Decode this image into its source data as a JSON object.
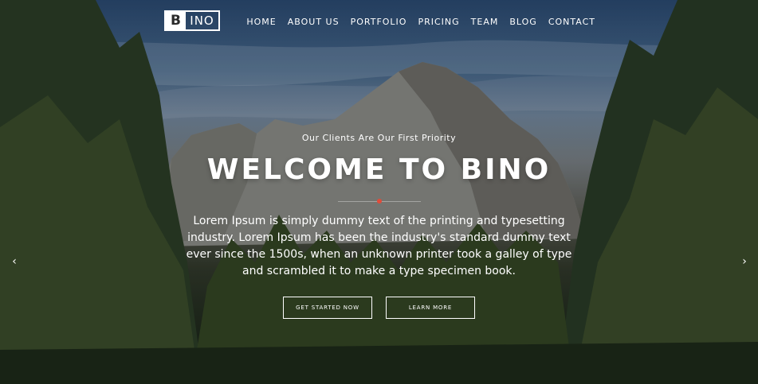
{
  "brand": {
    "logo_mark": "B",
    "logo_rest": "INO"
  },
  "nav": {
    "items": [
      {
        "label": "HOME"
      },
      {
        "label": "ABOUT US"
      },
      {
        "label": "PORTFOLIO"
      },
      {
        "label": "PRICING"
      },
      {
        "label": "TEAM"
      },
      {
        "label": "BLOG"
      },
      {
        "label": "CONTACT"
      }
    ]
  },
  "hero": {
    "kicker": "Our Clients Are Our First Priority",
    "title": "WELCOME TO BINO",
    "description": "Lorem Ipsum is simply dummy text of the printing and typesetting industry. Lorem Ipsum has been the industry's standard dummy text ever since the 1500s, when an unknown printer took a galley of type and scrambled it to make a type specimen book.",
    "primary_button": "GET STARTED NOW",
    "secondary_button": "LEARN MORE",
    "accent_color": "#e14b3a"
  },
  "slider": {
    "prev_icon": "chevron-left-icon",
    "next_icon": "chevron-right-icon",
    "prev_glyph": "‹",
    "next_glyph": "›"
  }
}
